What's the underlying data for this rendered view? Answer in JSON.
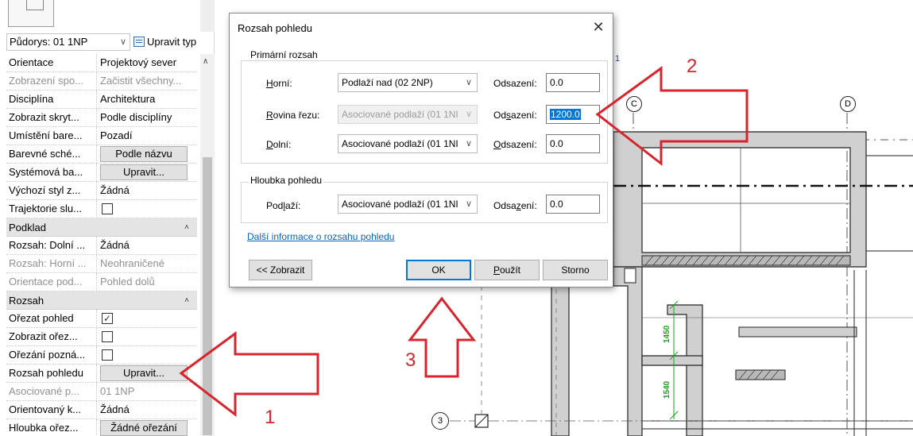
{
  "properties": {
    "type_selector": "Půdorys: 01 1NP",
    "edit_type_label": "Upravit typ",
    "rows_top": [
      {
        "name": "Orientace",
        "value": "Projektový sever",
        "kind": "text",
        "grey": false
      },
      {
        "name": "Zobrazení spo...",
        "value": "Začistit všechny...",
        "kind": "text",
        "grey": true
      },
      {
        "name": "Disciplína",
        "value": "Architektura",
        "kind": "text",
        "grey": false
      },
      {
        "name": "Zobrazit skryt...",
        "value": "Podle disciplíny",
        "kind": "text",
        "grey": false
      },
      {
        "name": "Umístění bare...",
        "value": "Pozadí",
        "kind": "text",
        "grey": false
      },
      {
        "name": "Barevné sché...",
        "value": "Podle názvu",
        "kind": "button",
        "grey": false
      },
      {
        "name": "Systémová ba...",
        "value": "Upravit...",
        "kind": "button",
        "grey": false
      },
      {
        "name": "Výchozí styl z...",
        "value": "Žádná",
        "kind": "text",
        "grey": false
      },
      {
        "name": "Trajektorie slu...",
        "value": "",
        "kind": "check",
        "checked": false,
        "grey": false
      }
    ],
    "category_podklad": "Podklad",
    "rows_podklad": [
      {
        "name": "Rozsah: Dolní ...",
        "value": "Žádná",
        "kind": "text",
        "grey": false
      },
      {
        "name": "Rozsah: Horní ...",
        "value": "Neohraničené",
        "kind": "text",
        "grey": true
      },
      {
        "name": "Orientace pod...",
        "value": "Pohled dolů",
        "kind": "text",
        "grey": true
      }
    ],
    "category_rozsah": "Rozsah",
    "rows_rozsah": [
      {
        "name": "Ořezat pohled",
        "value": "",
        "kind": "check",
        "checked": true,
        "grey": false
      },
      {
        "name": "Zobrazit ořez...",
        "value": "",
        "kind": "check",
        "checked": false,
        "grey": false
      },
      {
        "name": "Ořezání pozná...",
        "value": "",
        "kind": "check",
        "checked": false,
        "grey": false
      },
      {
        "name": "Rozsah pohledu",
        "value": "Upravit...",
        "kind": "button",
        "grey": false
      },
      {
        "name": "Asociované p...",
        "value": "01 1NP",
        "kind": "text",
        "grey": true
      },
      {
        "name": "Orientovaný k...",
        "value": "Žádná",
        "kind": "text",
        "grey": false
      },
      {
        "name": "Hloubka ořez...",
        "value": "Žádné ořezání",
        "kind": "button",
        "grey": false
      }
    ]
  },
  "dialog": {
    "title": "Rozsah pohledu",
    "close_glyph": "✕",
    "primary_group": "Primární rozsah",
    "top_label": "Horní:",
    "top_value": "Podlaží nad (02 2NP)",
    "top_offset_label": "Odsazení:",
    "top_offset": "0.0",
    "cut_label": "Rovina řezu:",
    "cut_value": "Asociované podlaží (01 1NI",
    "cut_offset_label": "Odsazení:",
    "cut_offset": "1200.0",
    "bottom_label": "Dolní:",
    "bottom_value": "Asociované podlaží (01 1NI",
    "bottom_offset_label": "Odsazení:",
    "bottom_offset": "0.0",
    "depth_group": "Hloubka pohledu",
    "level_label": "Podlaží:",
    "level_value": "Asociované podlaží (01 1NI",
    "level_offset_label": "Odsazení:",
    "level_offset": "0.0",
    "link": "Další informace o rozsahu pohledu",
    "show_button": "<< Zobrazit",
    "ok_button": "OK",
    "apply_button": "Použít",
    "cancel_button": "Storno"
  },
  "drawing": {
    "grid_c": "C",
    "grid_d": "D",
    "grid_3": "3",
    "dim_1450": "1450",
    "dim_1540": "1540",
    "dim_color": "#1aa31a",
    "fragment_1": "1"
  },
  "annotations": {
    "color": "#d8242c",
    "n1": "1",
    "n2": "2",
    "n3": "3"
  }
}
